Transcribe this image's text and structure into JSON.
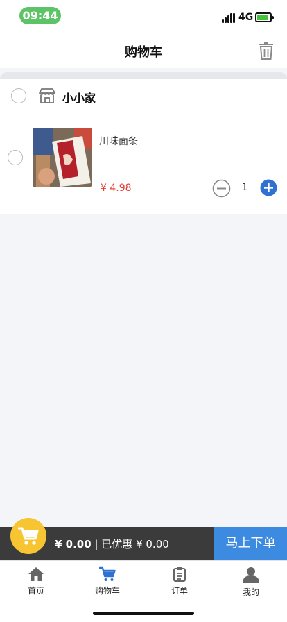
{
  "status": {
    "time": "09:44",
    "network": "4G"
  },
  "header": {
    "title": "购物车",
    "trash_icon": "trash-icon"
  },
  "shop": {
    "name": "小小家",
    "items": [
      {
        "name": "川味面条",
        "price": "¥ 4.98",
        "quantity": "1"
      }
    ]
  },
  "checkout": {
    "total": "¥ 0.00",
    "separator": "|",
    "discount": "已优惠 ¥ 0.00",
    "button": "马上下单"
  },
  "tabs": [
    {
      "label": "首页",
      "icon": "home-icon"
    },
    {
      "label": "购物车",
      "icon": "cart-icon",
      "active": true
    },
    {
      "label": "订单",
      "icon": "clipboard-icon"
    },
    {
      "label": "我的",
      "icon": "user-icon"
    }
  ],
  "colors": {
    "accent": "#3d8be0",
    "price": "#e33b2e",
    "cart_circle": "#f7c531",
    "checkout_bg": "#3b3b3b",
    "time_pill": "#5cc466"
  }
}
